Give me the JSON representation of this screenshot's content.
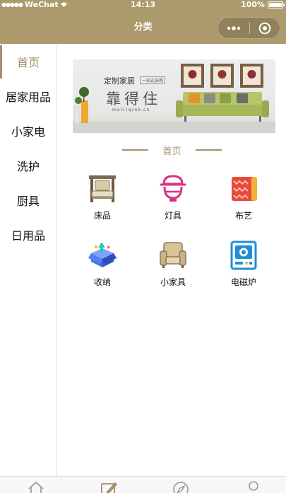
{
  "status_bar": {
    "carrier": "WeChat",
    "time": "14:13",
    "battery": "100%",
    "battery_level": 1.0
  },
  "nav": {
    "title": "分类"
  },
  "sidebar": {
    "items": [
      {
        "label": "首页",
        "active": true
      },
      {
        "label": "居家用品"
      },
      {
        "label": "小家电"
      },
      {
        "label": "洗护"
      },
      {
        "label": "厨具"
      },
      {
        "label": "日用品"
      }
    ]
  },
  "banner": {
    "title": "定制家居",
    "tag": "一站式采购",
    "brand": "靠得住",
    "url": "mall.lqcnb.cn"
  },
  "section": {
    "title": "首页"
  },
  "categories": [
    {
      "label": "床品",
      "icon": "bed-icon"
    },
    {
      "label": "灯具",
      "icon": "lamp-icon"
    },
    {
      "label": "布艺",
      "icon": "fabric-icon"
    },
    {
      "label": "收纳",
      "icon": "storage-box-icon"
    },
    {
      "label": "小家具",
      "icon": "armchair-icon"
    },
    {
      "label": "电磁炉",
      "icon": "induction-cooker-icon"
    }
  ],
  "tabbar": {
    "icons": [
      "home-icon",
      "edit-icon",
      "compass-icon",
      "profile-icon"
    ]
  },
  "colors": {
    "nav_bg": "#ad9a6c",
    "accent": "#a4906a"
  }
}
